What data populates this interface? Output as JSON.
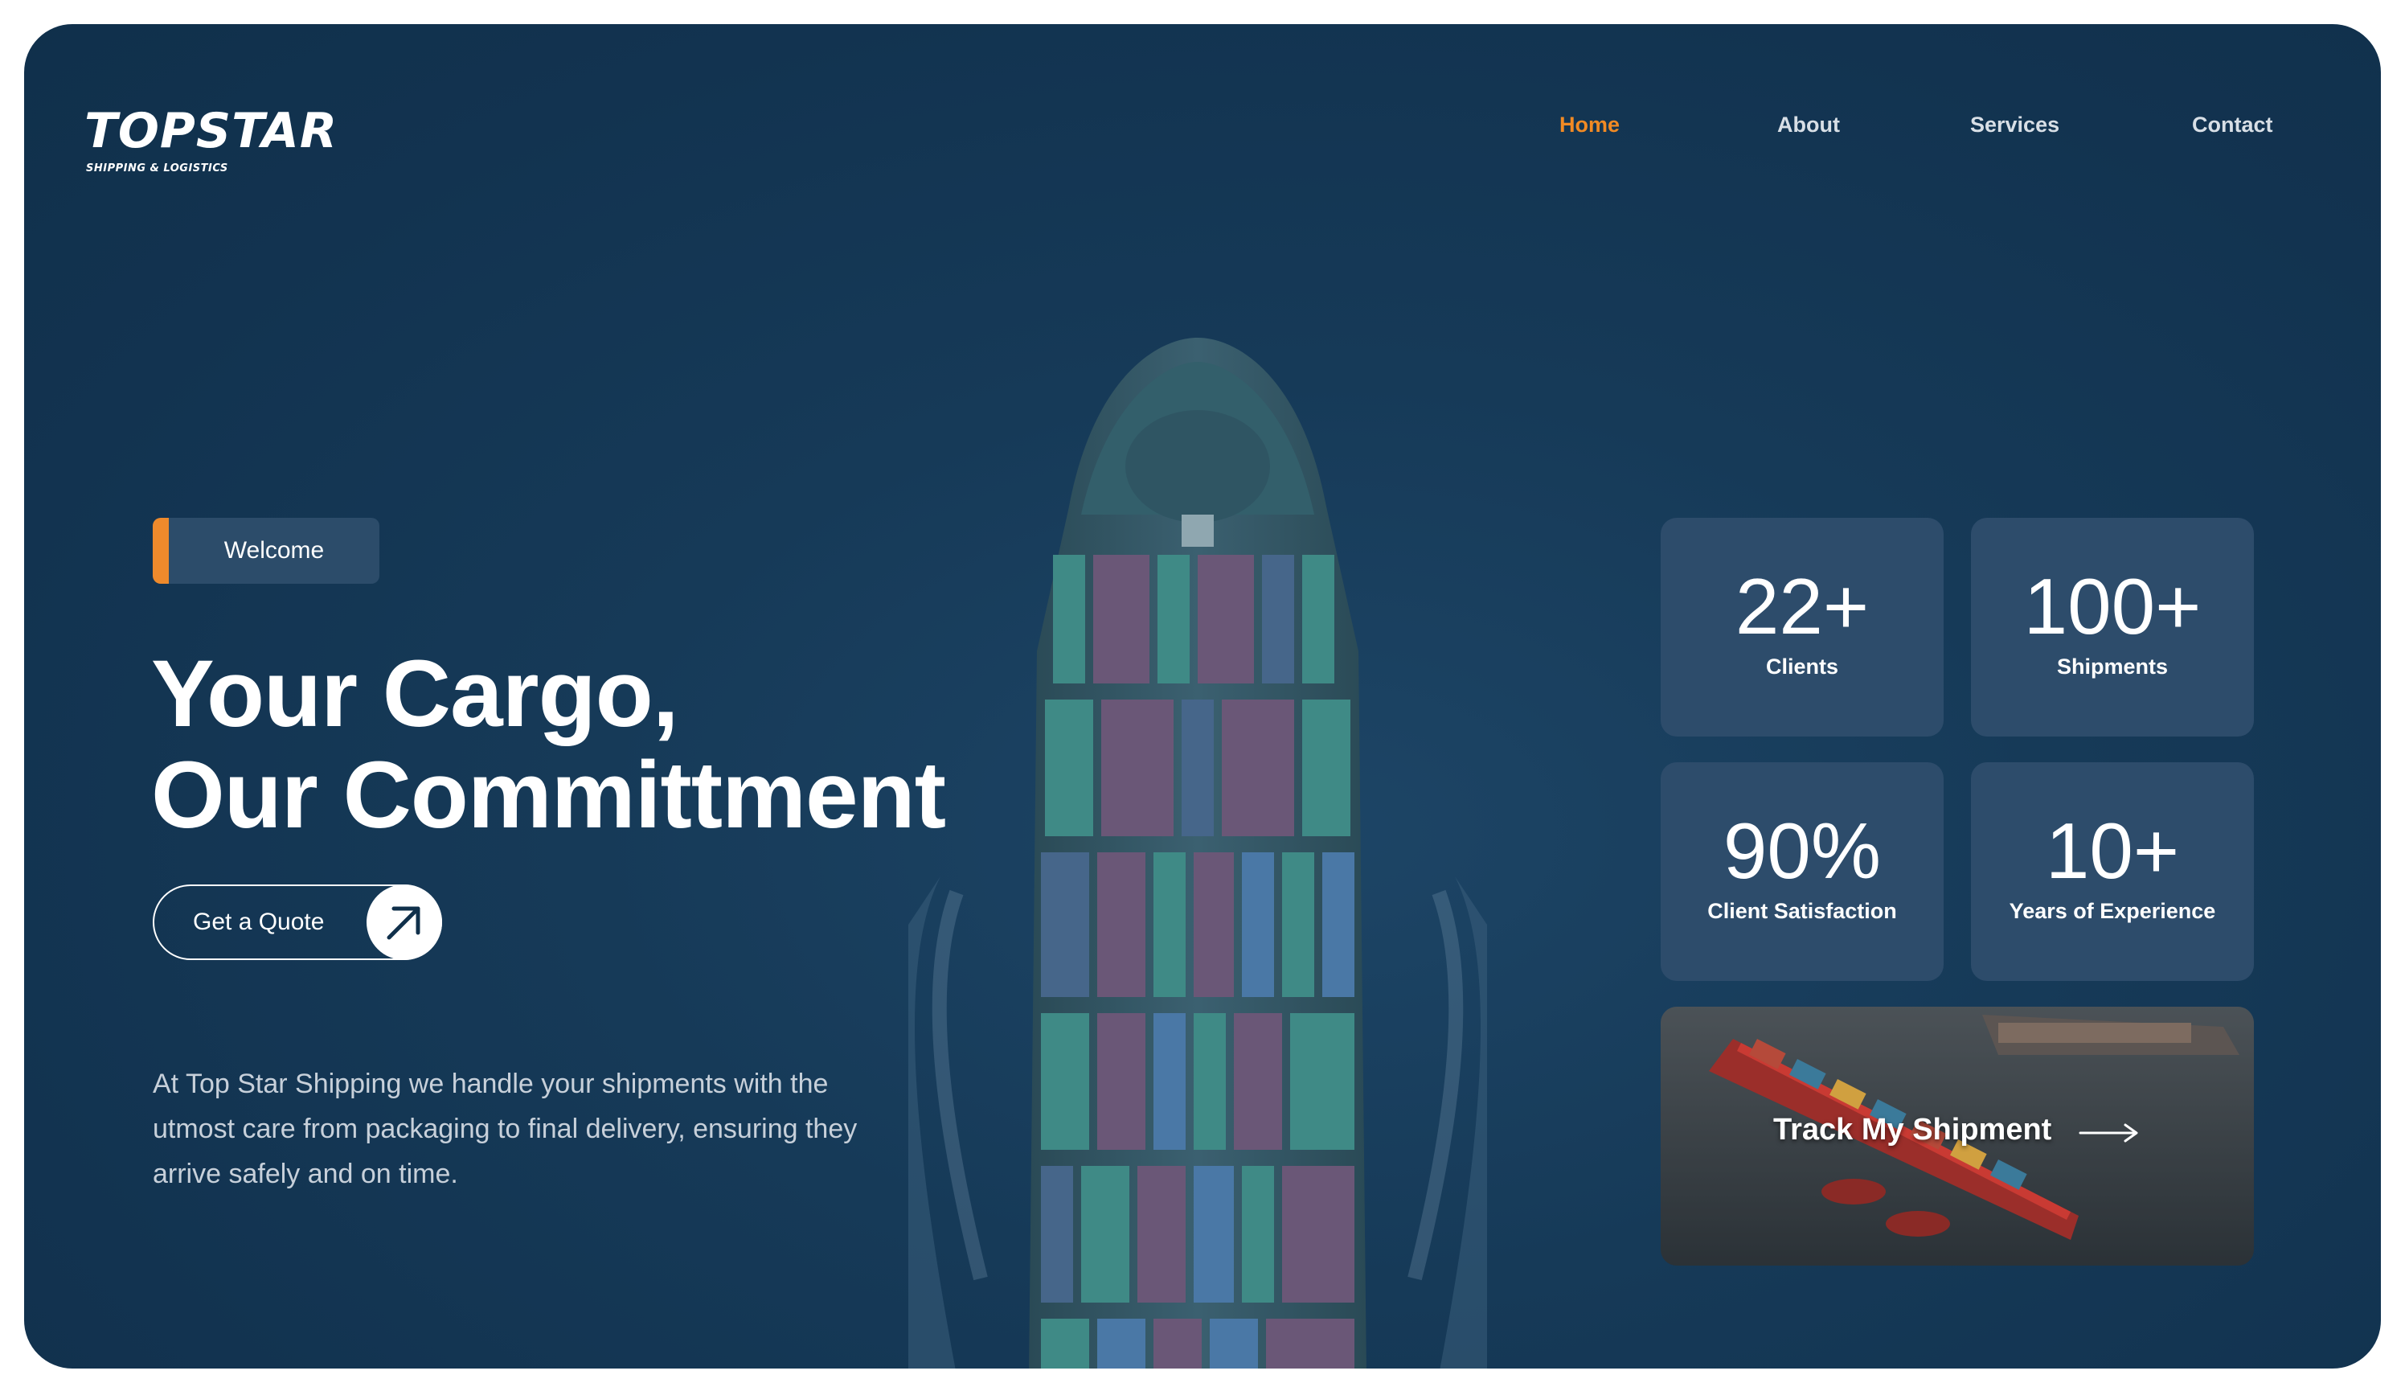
{
  "brand": {
    "name": "TOPSTAR",
    "tagline": "SHIPPING & LOGISTICS",
    "accent_color": "#f18a24",
    "background_color": "#143657"
  },
  "nav": {
    "items": [
      {
        "label": "Home",
        "active": true
      },
      {
        "label": "About",
        "active": false
      },
      {
        "label": "Services",
        "active": false
      },
      {
        "label": "Contact",
        "active": false
      }
    ]
  },
  "hero": {
    "badge": "Welcome",
    "headline_line1": "Your Cargo,",
    "headline_line2": "Our Committment",
    "cta_label": "Get a Quote",
    "cta_icon": "arrow-up-right-icon",
    "intro": "At Top Star Shipping we handle your shipments with the utmost care from packaging to final delivery, ensuring they arrive safely and on time."
  },
  "stats": [
    {
      "value": "22+",
      "label": "Clients"
    },
    {
      "value": "100+",
      "label": "Shipments"
    },
    {
      "value": "90%",
      "label": "Client Satisfaction"
    },
    {
      "value": "10+",
      "label": "Years of Experience"
    }
  ],
  "track": {
    "label": "Track My Shipment",
    "icon": "arrow-right-icon"
  }
}
